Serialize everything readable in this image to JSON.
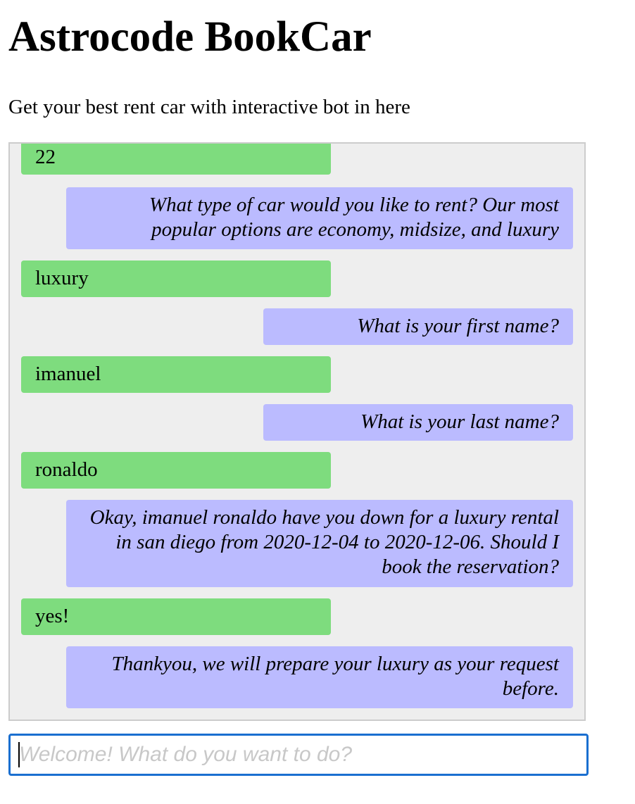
{
  "header": {
    "title": "Astrocode BookCar",
    "subtitle": "Get your best rent car with interactive bot in here"
  },
  "conversation": {
    "messages": [
      {
        "sender": "user",
        "text": "22"
      },
      {
        "sender": "bot",
        "text": "What type of car would you like to rent? Our most popular options are economy, midsize, and luxury"
      },
      {
        "sender": "user",
        "text": "luxury"
      },
      {
        "sender": "bot",
        "text": "What is your first name?"
      },
      {
        "sender": "user",
        "text": "imanuel"
      },
      {
        "sender": "bot",
        "text": "What is your last name?"
      },
      {
        "sender": "user",
        "text": "ronaldo"
      },
      {
        "sender": "bot",
        "text": "Okay, imanuel ronaldo have you down for a luxury rental in san diego from 2020-12-04 to 2020-12-06. Should I book the reservation?"
      },
      {
        "sender": "user",
        "text": "yes!"
      },
      {
        "sender": "bot",
        "text": "Thankyou, we will prepare your luxury as your request before."
      }
    ]
  },
  "input": {
    "value": "",
    "placeholder": "Welcome! What do you want to do?"
  },
  "colors": {
    "user_bubble": "#7edc7e",
    "bot_bubble": "#bbbbff",
    "conversation_bg": "#eeeeee",
    "input_focus_border": "#1a6fd0"
  }
}
